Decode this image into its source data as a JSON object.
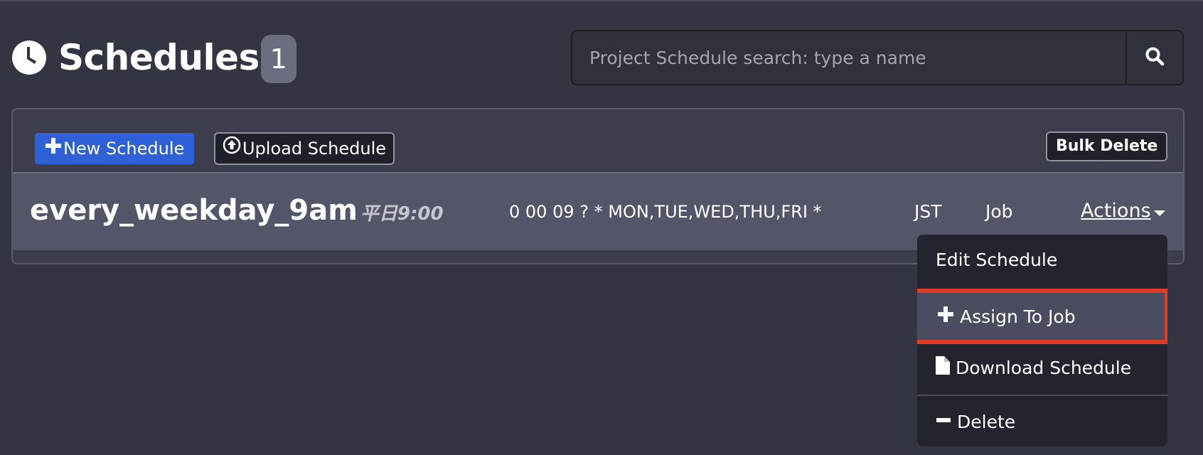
{
  "header": {
    "title": "Schedules",
    "count": "1"
  },
  "search": {
    "placeholder": "Project Schedule search: type a name",
    "icon": "search-icon"
  },
  "toolbar": {
    "new_label": "New Schedule",
    "upload_label": "Upload Schedule",
    "bulk_delete_label": "Bulk Delete"
  },
  "schedule": {
    "name": "every_weekday_9am",
    "description": "平日9:00",
    "cron": "0 00 09 ? * MON,TUE,WED,THU,FRI *",
    "timezone": "JST",
    "type": "Job",
    "actions_label": "Actions"
  },
  "menu": {
    "edit": "Edit Schedule",
    "assign": "Assign To Job",
    "download": "Download Schedule",
    "delete": "Delete"
  },
  "colors": {
    "background": "#333542",
    "primary": "#2e60d8",
    "highlight": "#e13b26"
  }
}
